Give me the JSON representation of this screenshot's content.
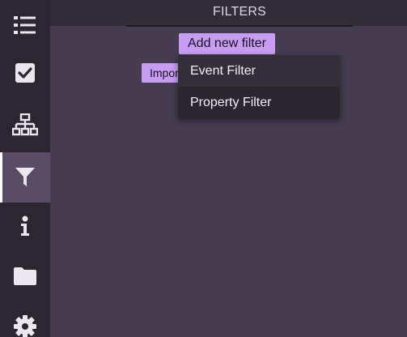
{
  "header": {
    "title": "FILTERS"
  },
  "sidebar": {
    "items": [
      {
        "icon": "list-icon"
      },
      {
        "icon": "checkbox-icon"
      },
      {
        "icon": "network-icon"
      },
      {
        "icon": "filter-icon",
        "active": true
      },
      {
        "icon": "info-icon"
      },
      {
        "icon": "folder-icon"
      },
      {
        "icon": "gear-icon"
      }
    ]
  },
  "main": {
    "add_filter_label": "Add new filter",
    "import_label": "Import"
  },
  "dropdown": {
    "items": [
      {
        "label": "Event Filter"
      },
      {
        "label": "Property Filter"
      }
    ]
  },
  "colors": {
    "accent": "#c79df4",
    "background": "#463c50",
    "sidebar": "#2b2631",
    "icon": "#ebe6f0"
  }
}
